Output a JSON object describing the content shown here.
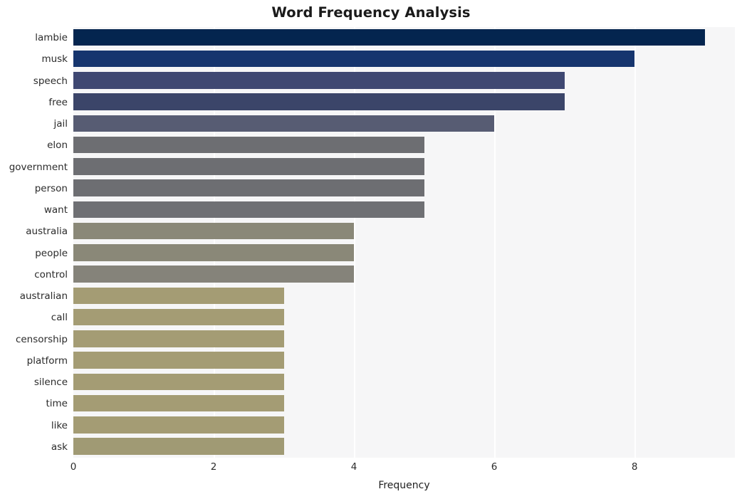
{
  "chart_data": {
    "type": "bar",
    "orientation": "horizontal",
    "title": "Word Frequency Analysis",
    "xlabel": "Frequency",
    "ylabel": "",
    "categories": [
      "lambie",
      "musk",
      "speech",
      "free",
      "jail",
      "elon",
      "government",
      "person",
      "want",
      "australia",
      "people",
      "control",
      "australian",
      "call",
      "censorship",
      "platform",
      "silence",
      "time",
      "like",
      "ask"
    ],
    "values": [
      9,
      8,
      7,
      7,
      6,
      5,
      5,
      5,
      5,
      4,
      4,
      4,
      3,
      3,
      3,
      3,
      3,
      3,
      3,
      3
    ],
    "bar_colors": [
      "#04254f",
      "#16356e",
      "#3f4872",
      "#3b4569",
      "#575c73",
      "#6d6e72",
      "#6d6e72",
      "#6d6e72",
      "#6f7074",
      "#8a8878",
      "#8a8878",
      "#85837a",
      "#a49c74",
      "#a49c74",
      "#a49c74",
      "#a49c74",
      "#a49c74",
      "#a49c74",
      "#a49c74",
      "#a09a74"
    ],
    "xlim": [
      0,
      9.43
    ],
    "xticks": [
      0,
      2,
      4,
      6,
      8
    ],
    "xtick_labels": [
      "0",
      "2",
      "4",
      "6",
      "8"
    ],
    "grid": "vertical-white",
    "legend": "none",
    "plot_background": "#f6f6f7",
    "figure_background": "#ffffff",
    "title_color": "#1a1a1a",
    "tick_label_color": "#2b2b2b"
  }
}
